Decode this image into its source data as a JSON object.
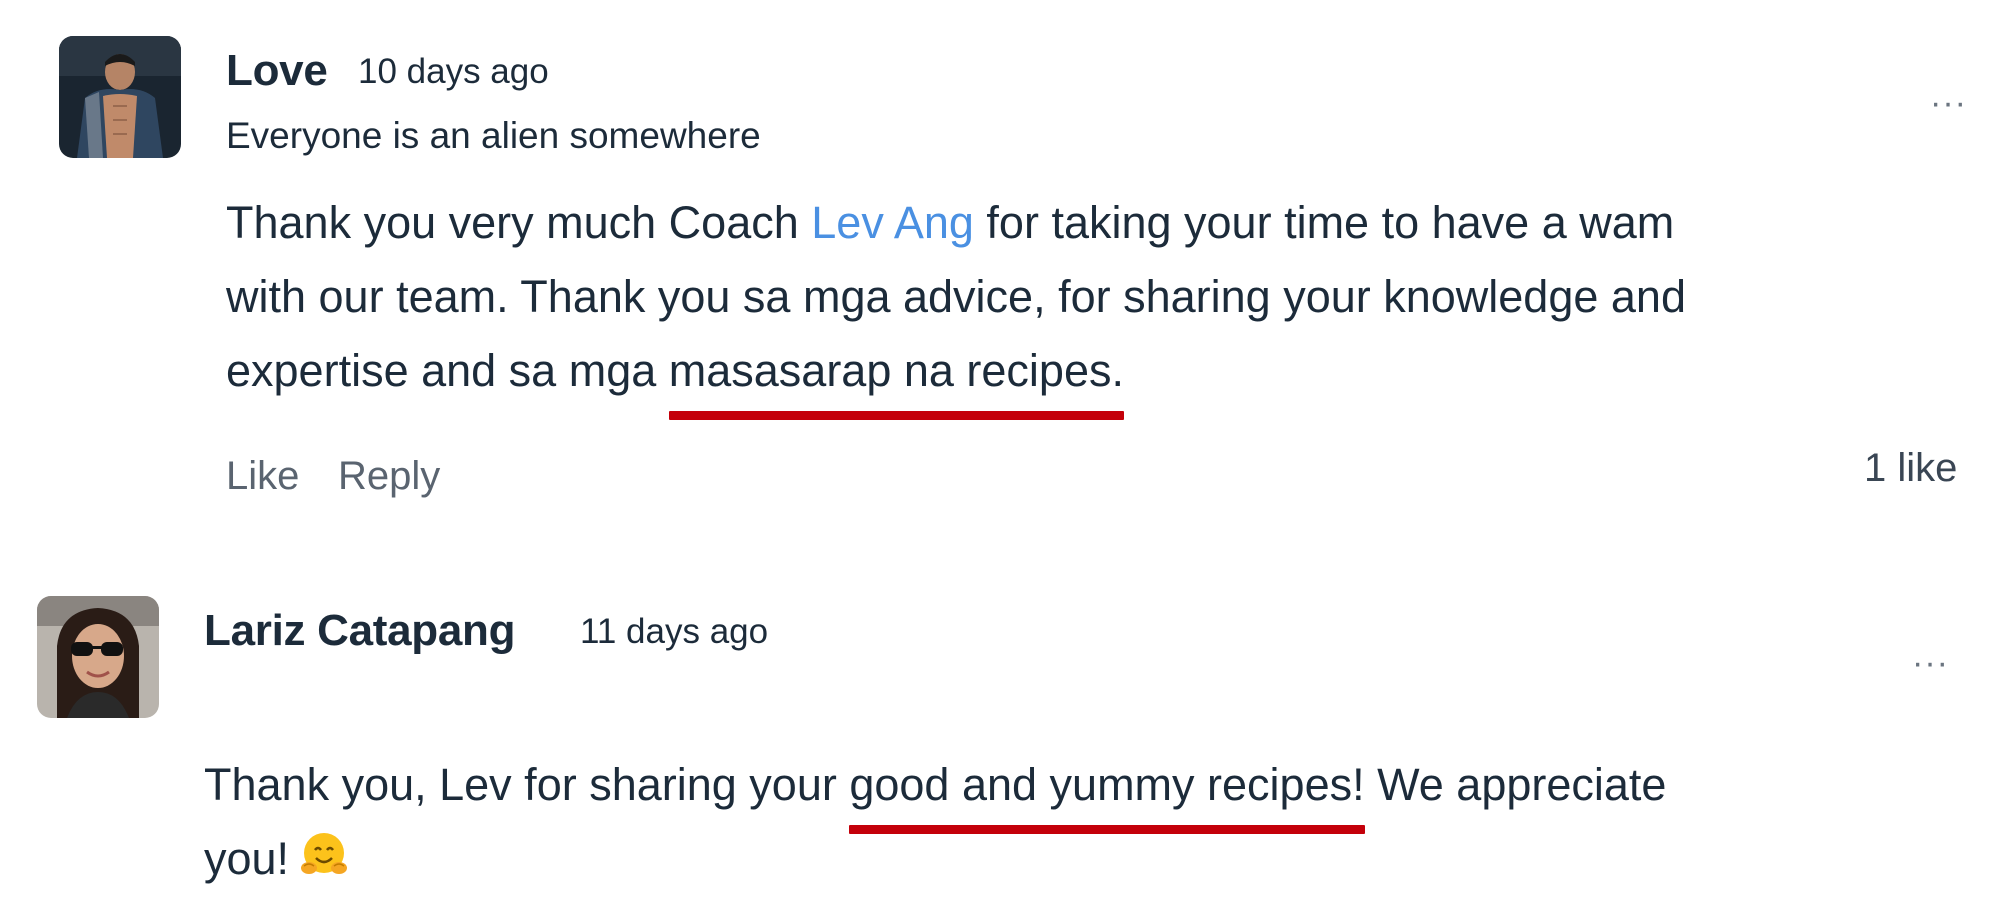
{
  "comments": [
    {
      "author": "Love",
      "timestamp": "10 days ago",
      "title": "Everyone is an alien somewhere",
      "body": {
        "line1_before": "Thank you very much Coach ",
        "mention": "Lev Ang",
        "line1_after": " for taking your time to have a wam",
        "line2": "with our team. Thank you sa mga advice, for sharing your knowledge and",
        "line3_before": "expertise and sa mga ",
        "line3_highlight": "masasarap na recipes."
      },
      "actions": {
        "like": "Like",
        "reply": "Reply"
      },
      "like_count": "1 like",
      "more": "···"
    },
    {
      "author": "Lariz Catapang",
      "timestamp": "11 days ago",
      "body": {
        "line1_before": "Thank you, Lev for sharing your ",
        "line1_highlight": "good and yummy recipes!",
        "line1_after": " We appreciate",
        "line2": "you!"
      },
      "emoji": "hugging-face-icon",
      "more": "···"
    }
  ],
  "colors": {
    "text": "#1c2b3a",
    "mention": "#4a90e2",
    "underline": "#c4000a",
    "muted": "#5a6470"
  }
}
